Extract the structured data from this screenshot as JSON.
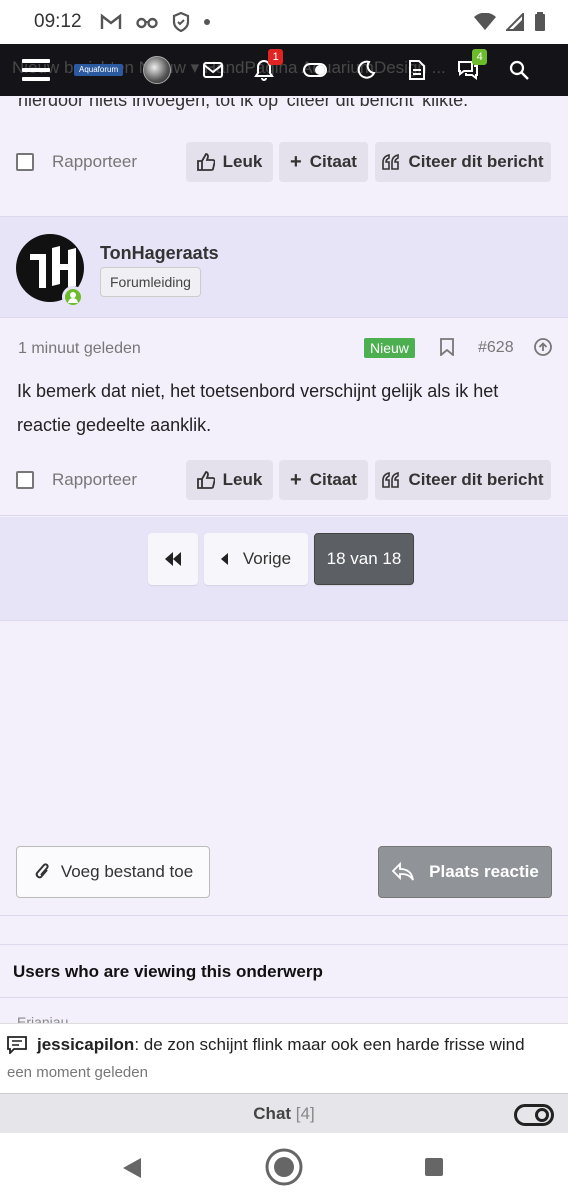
{
  "status_bar": {
    "time": "09:12"
  },
  "nav": {
    "ghost_links": "Nieuw berichten   Nieuw ▾      HandPagina    AquariumDesign    ...",
    "logo_text": "Aquaforum",
    "notifications_count": "1",
    "conversations_count": "4"
  },
  "prev_post": {
    "cut_text": "hierdoor niets invoegen, tot ik op 'citeer dit bericht' klikte.",
    "report_label": "Rapporteer",
    "like_label": "Leuk",
    "quote_label": "Citaat",
    "quote_post_label": "Citeer dit bericht"
  },
  "author": {
    "name": "TonHageraats",
    "role": "Forumleiding"
  },
  "post": {
    "time": "1 minuut geleden",
    "new_badge": "Nieuw",
    "number": "#628",
    "text": "Ik bemerk dat niet, het toetsenbord verschijnt gelijk als ik het reactie gedeelte aanklik.",
    "report_label": "Rapporteer",
    "like_label": "Leuk",
    "quote_label": "Citaat",
    "quote_post_label": "Citeer dit bericht"
  },
  "pagination": {
    "prev_label": "Vorige",
    "current": "18 van 18"
  },
  "reply": {
    "attach_label": "Voeg bestand toe",
    "submit_label": "Plaats reactie"
  },
  "viewers": {
    "title": "Users who are viewing this onderwerp",
    "peek": "Erianiau"
  },
  "shoutbox": {
    "user": "jessicapilon",
    "message": ": de zon schijnt flink maar ook een harde frisse wind",
    "time": "een moment geleden"
  },
  "chat": {
    "title": "Chat",
    "count": "[4]"
  },
  "colors": {
    "new_badge": "#4caf50",
    "notif_badge": "#e02424",
    "conv_badge": "#6cbb2c",
    "page_bg": "#f3f0fb",
    "band_bg": "#e8e4f8"
  }
}
